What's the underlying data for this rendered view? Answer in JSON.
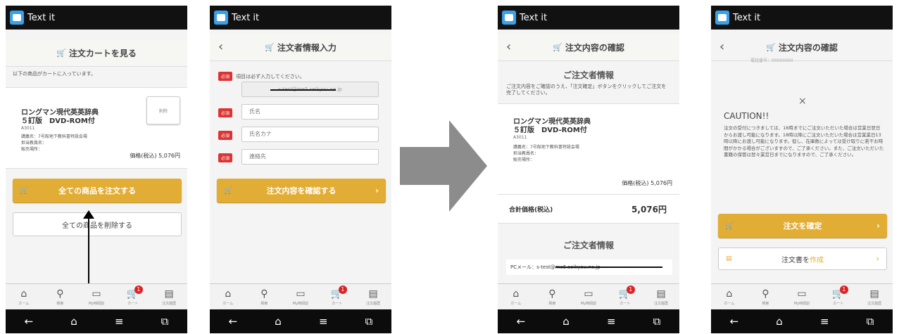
{
  "app_name": "Text it",
  "tabs": [
    {
      "icon": "⌂",
      "label": "ホーム",
      "name": "home-icon"
    },
    {
      "icon": "⚲",
      "label": "検索",
      "name": "search-icon"
    },
    {
      "icon": "▭",
      "label": "My時間割",
      "name": "timetable-icon"
    },
    {
      "icon": "🛒",
      "label": "カート",
      "name": "cart-icon"
    },
    {
      "icon": "▤",
      "label": "注文履歴",
      "name": "history-icon"
    }
  ],
  "cart_badge": "1",
  "sys_buttons": [
    "←",
    "⌂",
    "≡",
    "⧉"
  ],
  "product": {
    "name_line1": "ロングマン現代英英辞典",
    "name_line2": "５訂版　DVD-ROM付",
    "code": "A3011",
    "lecture": "講義名：7号館地下教科書特設会場",
    "teacher": "担当教員名：",
    "place": "販売場所：",
    "price": "価格(税込) 5,076円"
  },
  "screen1": {
    "title": "注文カートを見る",
    "note": "以下の商品がカートに入っています。",
    "delete_label": "削除",
    "order_all": "全ての商品を注文する",
    "delete_all": "全ての商品を削除する"
  },
  "screen2": {
    "title": "注文者情報入力",
    "required_badge": "必須",
    "required_note": "項目は必ず入力してください。",
    "email": "s-test@me5.seikyou.ne.jp",
    "name_placeholder": "氏名",
    "kana_placeholder": "氏名カナ",
    "contact_placeholder": "連絡先",
    "confirm_btn": "注文内容を確認する"
  },
  "screen3": {
    "title": "注文内容の確認",
    "section1": "ご注文者情報",
    "instruction": "ご注文内容をご確認のうえ、「注文確定」ボタンをクリックしてご注文を完了してください。",
    "total_label": "合計価格(税込)",
    "total_value": "5,076円",
    "section2": "ご注文者情報",
    "pc_mail": "PCメール：s-test@me5.seikyou.ne.jp"
  },
  "screen4": {
    "title": "注文内容の確認",
    "phone_partial": "電話番号：00000000",
    "close": "×",
    "caution_title": "CAUTION!!",
    "caution_text": "注文の受付につきましては、18時までにご注文いただいた場合は営業日翌日からお渡し可能になります。18時以降にご注文いただいた場合は営業業日13時以降にお渡し可能になります。但し、在庫数によっては受け取りに若干お時間がかかる場合がございますので、ご了承ください。また、ご注文いただいた書籍の保管は翌々業営日までになりますので、ご了承ください。",
    "confirm_order": "注文を確定",
    "create_doc_a": "注文書を",
    "create_doc_b": "作成"
  },
  "colors": {
    "accent": "#e2ad34",
    "required": "#d33333",
    "arrow": "#8c8c8c"
  }
}
